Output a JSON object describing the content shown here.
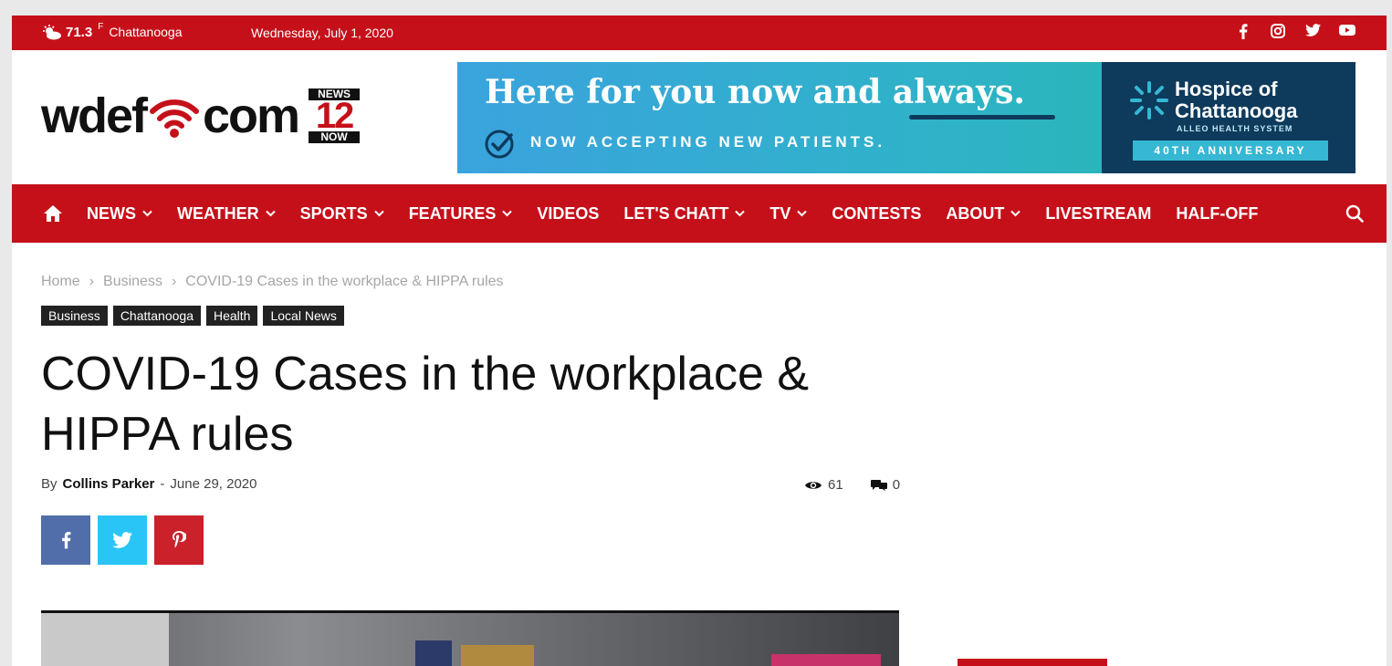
{
  "topbar": {
    "temperature": "71.3",
    "unit": "F",
    "city": "Chattanooga",
    "date": "Wednesday, July 1, 2020",
    "social_icons": [
      "facebook-icon",
      "instagram-icon",
      "twitter-icon",
      "youtube-icon"
    ]
  },
  "header": {
    "logo_left": "wdef",
    "logo_right": "com",
    "badge_top": "NEWS",
    "badge_mid": "12",
    "badge_bot": "NOW"
  },
  "ad": {
    "headline": "Here for you now and always.",
    "subline": "NOW ACCEPTING NEW PATIENTS.",
    "org_line1": "Hospice of",
    "org_line2": "Chattanooga",
    "org_system": "ALLEO HEALTH SYSTEM",
    "ribbon": "40TH ANNIVERSARY"
  },
  "nav": {
    "items": [
      {
        "label": "NEWS",
        "dropdown": true
      },
      {
        "label": "WEATHER",
        "dropdown": true
      },
      {
        "label": "SPORTS",
        "dropdown": true
      },
      {
        "label": "FEATURES",
        "dropdown": true
      },
      {
        "label": "VIDEOS",
        "dropdown": false
      },
      {
        "label": "LET'S CHATT",
        "dropdown": true
      },
      {
        "label": "TV",
        "dropdown": true
      },
      {
        "label": "CONTESTS",
        "dropdown": false
      },
      {
        "label": "ABOUT",
        "dropdown": true
      },
      {
        "label": "LIVESTREAM",
        "dropdown": false
      },
      {
        "label": "HALF-OFF",
        "dropdown": false
      }
    ]
  },
  "breadcrumb": {
    "home": "Home",
    "sep": "›",
    "section": "Business",
    "current": "COVID-19 Cases in the workplace & HIPPA rules"
  },
  "tags": [
    "Business",
    "Chattanooga",
    "Health",
    "Local News"
  ],
  "article": {
    "title": "COVID-19 Cases in the workplace & HIPPA rules",
    "by": "By",
    "author": "Collins Parker",
    "dash": "-",
    "date": "June 29, 2020",
    "views": "61",
    "comments": "0"
  },
  "share": {
    "facebook": "f",
    "twitter": "twitter-icon",
    "pinterest": "pinterest-icon"
  },
  "colors": {
    "brand_red": "#c5101a",
    "dark": "#111111",
    "facebook": "#516eab",
    "twitter": "#29c5f6",
    "pinterest": "#ca212a"
  }
}
